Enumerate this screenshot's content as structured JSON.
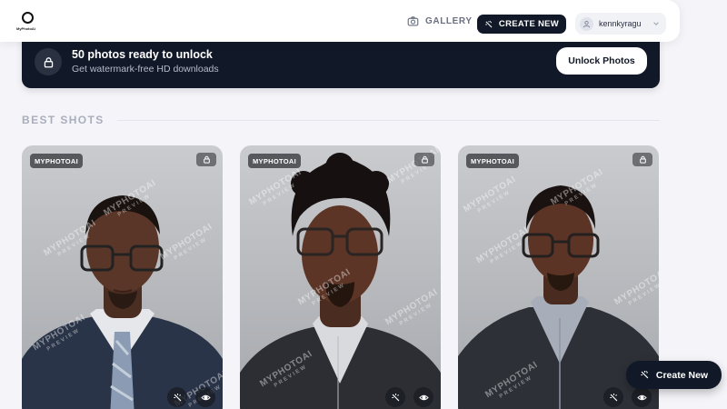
{
  "header": {
    "logo_text": "MyPhotoAi",
    "gallery_label": "GALLERY",
    "create_label": "CREATE NEW",
    "username": "kennkyragu"
  },
  "banner": {
    "title": "50 photos ready to unlock",
    "subtitle": "Get watermark-free HD downloads",
    "button_label": "Unlock Photos"
  },
  "section": {
    "title": "BEST SHOTS"
  },
  "photos": [
    {
      "badge": "MYPHOTOAI",
      "watermark": "MYPHOTOAI",
      "watermark_sub": "PREVIEW"
    },
    {
      "badge": "MYPHOTOAI",
      "watermark": "MYPHOTOAI",
      "watermark_sub": "PREVIEW"
    },
    {
      "badge": "MYPHOTOAI",
      "watermark": "MYPHOTOAI",
      "watermark_sub": "PREVIEW"
    }
  ],
  "fab": {
    "label": "Create New"
  },
  "icons": {
    "gallery": "camera-icon",
    "create": "sparkle-icon",
    "lock": "lock-icon",
    "view": "eye-icon",
    "user": "user-icon",
    "chevron": "chevron-down-icon"
  },
  "colors": {
    "dark": "#111827",
    "background": "#f5f5f9",
    "muted": "#a9aebc"
  }
}
